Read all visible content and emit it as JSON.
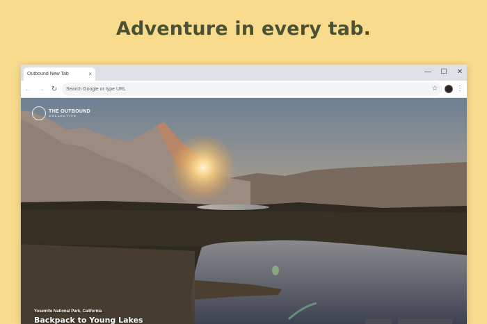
{
  "headline": "Adventure in every tab.",
  "browser": {
    "tab": {
      "title": "Outbound New Tab",
      "close_icon": "×"
    },
    "window_controls": {
      "minimize": "—",
      "maximize": "☐",
      "close": "✕"
    },
    "toolbar": {
      "back_icon": "←",
      "forward_icon": "→",
      "reload_icon": "↻",
      "omnibox_placeholder": "Search Google or type URL",
      "bookmark_icon": "☆",
      "menu_icon": "⋮"
    }
  },
  "page": {
    "logo": {
      "line1": "THE OUTBOUND",
      "line2": "COLLECTIVE"
    },
    "caption": {
      "location": "Yosemite National Park, California",
      "title": "Backpack to Young Lakes"
    }
  },
  "colors": {
    "background": "#f8db8c",
    "headline": "#4a5233",
    "tabstrip": "#dee1e6",
    "omnibox": "#f1f3f4"
  }
}
